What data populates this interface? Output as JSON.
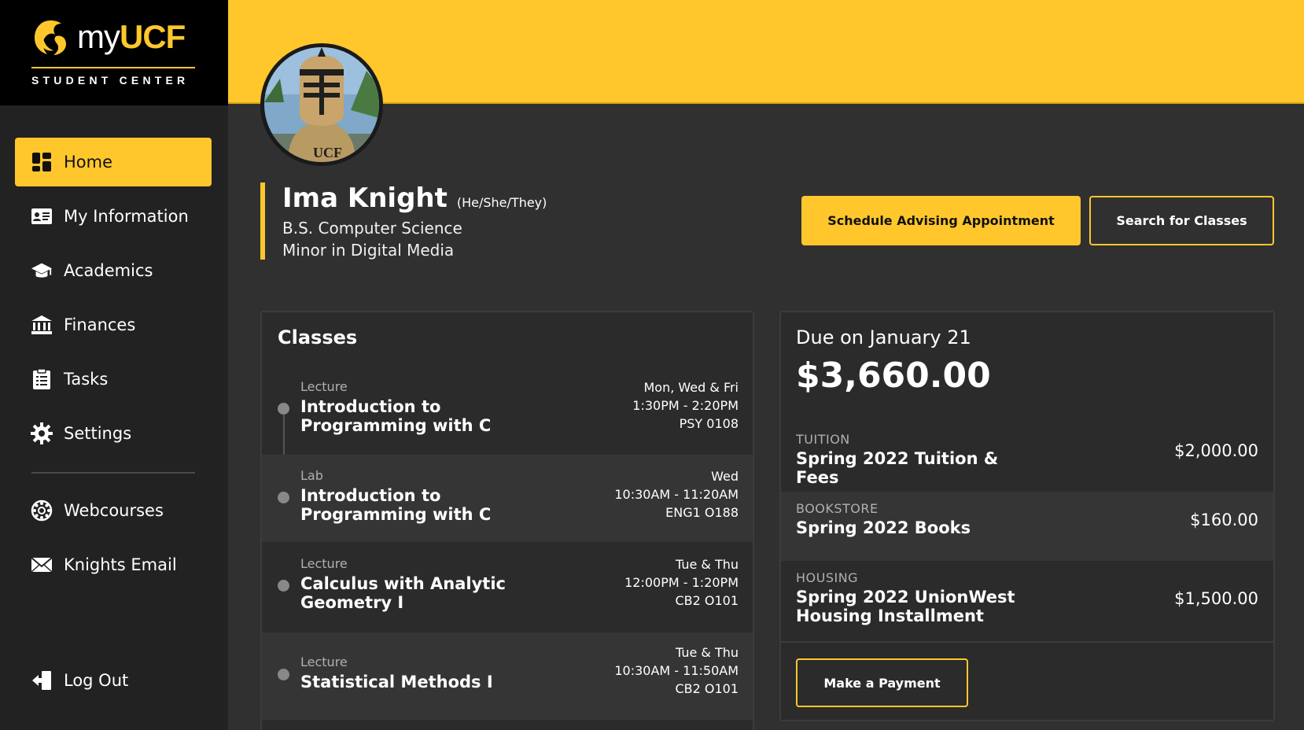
{
  "brand": {
    "logo_my": "my",
    "logo_ucf": "UCF",
    "subtitle": "STUDENT CENTER",
    "accent_color": "#FFC72C"
  },
  "nav": {
    "primary": [
      {
        "label": "Home",
        "icon": "dashboard-icon",
        "active": true
      },
      {
        "label": "My Information",
        "icon": "id-card-icon",
        "active": false
      },
      {
        "label": "Academics",
        "icon": "graduation-cap-icon",
        "active": false
      },
      {
        "label": "Finances",
        "icon": "bank-icon",
        "active": false
      },
      {
        "label": "Tasks",
        "icon": "clipboard-list-icon",
        "active": false
      },
      {
        "label": "Settings",
        "icon": "gear-icon",
        "active": false
      }
    ],
    "secondary": [
      {
        "label": "Webcourses",
        "icon": "canvas-icon"
      },
      {
        "label": "Knights Email",
        "icon": "envelope-icon"
      }
    ],
    "logout": {
      "label": "Log Out",
      "icon": "logout-icon"
    }
  },
  "profile": {
    "name": "Ima Knight",
    "pronouns": "(He/She/They)",
    "major": "B.S. Computer Science",
    "minor": "Minor in Digital Media"
  },
  "actions": {
    "advising": "Schedule Advising Appointment",
    "search_classes": "Search for Classes"
  },
  "classes": {
    "title": "Classes",
    "items": [
      {
        "type": "Lecture",
        "name": "Introduction to Programming with C",
        "days": "Mon, Wed & Fri",
        "time": "1:30PM - 2:20PM",
        "room": "PSY 0108"
      },
      {
        "type": "Lab",
        "name": "Introduction to Programming with C",
        "days": "Wed",
        "time": "10:30AM - 11:20AM",
        "room": "ENG1 O188"
      },
      {
        "type": "Lecture",
        "name": "Calculus with Analytic Geometry I",
        "days": "Tue & Thu",
        "time": "12:00PM - 1:20PM",
        "room": "CB2 O101"
      },
      {
        "type": "Lecture",
        "name": "Statistical Methods I",
        "days": "Tue & Thu",
        "time": "10:30AM - 11:50AM",
        "room": "CB2 O101"
      }
    ]
  },
  "finances": {
    "due_label": "Due on January 21",
    "due_amount": "$3,660.00",
    "items": [
      {
        "category": "TUITION",
        "description": "Spring 2022 Tuition & Fees",
        "amount": "$2,000.00"
      },
      {
        "category": "BOOKSTORE",
        "description": "Spring 2022 Books",
        "amount": "$160.00"
      },
      {
        "category": "HOUSING",
        "description": "Spring 2022 UnionWest Housing Installment",
        "amount": "$1,500.00"
      }
    ],
    "pay_button": "Make a Payment"
  }
}
